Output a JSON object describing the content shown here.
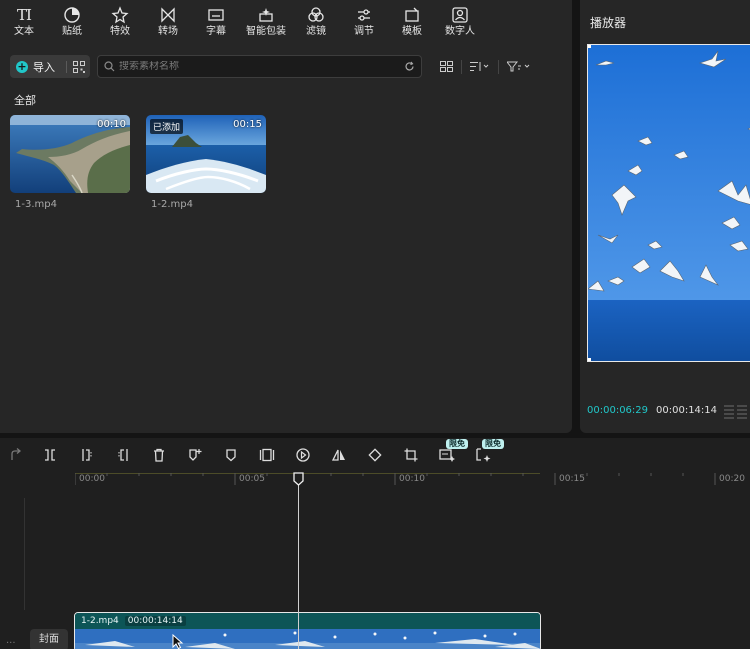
{
  "toolbar": {
    "items": [
      {
        "label": "文本",
        "icon": "text-icon"
      },
      {
        "label": "贴纸",
        "icon": "sticker-icon"
      },
      {
        "label": "特效",
        "icon": "effects-icon"
      },
      {
        "label": "转场",
        "icon": "transition-icon"
      },
      {
        "label": "字幕",
        "icon": "subtitle-icon"
      },
      {
        "label": "智能包装",
        "icon": "smart-pack-icon"
      },
      {
        "label": "滤镜",
        "icon": "filter-icon"
      },
      {
        "label": "调节",
        "icon": "adjust-icon"
      },
      {
        "label": "模板",
        "icon": "template-icon"
      },
      {
        "label": "数字人",
        "icon": "digital-human-icon"
      }
    ],
    "text_glyph": "TI"
  },
  "media": {
    "import_label": "导入",
    "search_placeholder": "搜索素材名称",
    "section_label": "全部",
    "clips": [
      {
        "name": "1-3.mp4",
        "duration": "00:10",
        "added": ""
      },
      {
        "name": "1-2.mp4",
        "duration": "00:15",
        "added": "已添加"
      }
    ]
  },
  "player": {
    "title": "播放器",
    "current_time": "00:00:06:29",
    "total_time": "00:00:14:14"
  },
  "timeline": {
    "badges": [
      "限免",
      "限免"
    ],
    "ruler_labels": [
      "00:00",
      "00:05",
      "00:10",
      "00:15",
      "00:20"
    ],
    "cover_label": "封面",
    "clip": {
      "name": "1-2.mp4",
      "duration": "00:00:14:14"
    }
  },
  "colors": {
    "accent": "#21c7c9",
    "panel": "#262626",
    "clip_bg": "#0d4d4f"
  }
}
